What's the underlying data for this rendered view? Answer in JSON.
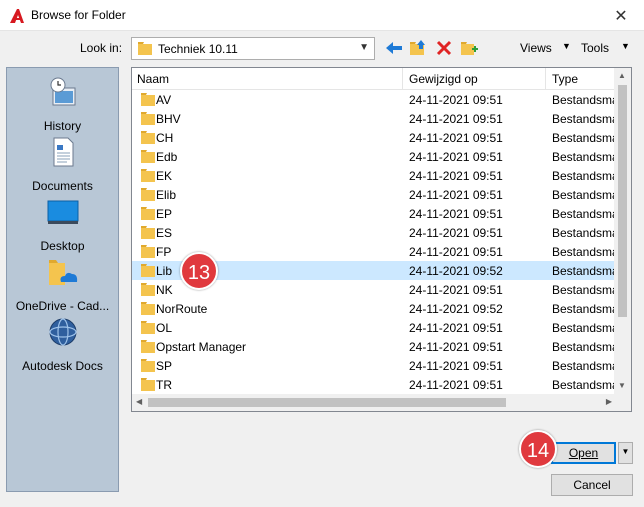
{
  "window": {
    "title": "Browse for Folder",
    "close_glyph": "✕"
  },
  "toolbar": {
    "lookin_label": "Look in:",
    "lookin_value": "Techniek 10.11",
    "views_label": "Views",
    "tools_label": "Tools"
  },
  "places": [
    {
      "label": "History",
      "icon": "history-icon"
    },
    {
      "label": "Documents",
      "icon": "documents-icon"
    },
    {
      "label": "Desktop",
      "icon": "desktop-icon"
    },
    {
      "label": "OneDrive - Cad...",
      "icon": "onedrive-icon"
    },
    {
      "label": "Autodesk Docs",
      "icon": "autodesk-docs-icon"
    }
  ],
  "columns": {
    "name": "Naam",
    "modified": "Gewijzigd op",
    "type": "Type"
  },
  "files": [
    {
      "name": "AV",
      "date": "24-11-2021 09:51",
      "type": "Bestandsma"
    },
    {
      "name": "BHV",
      "date": "24-11-2021 09:51",
      "type": "Bestandsma"
    },
    {
      "name": "CH",
      "date": "24-11-2021 09:51",
      "type": "Bestandsma"
    },
    {
      "name": "Edb",
      "date": "24-11-2021 09:51",
      "type": "Bestandsma"
    },
    {
      "name": "EK",
      "date": "24-11-2021 09:51",
      "type": "Bestandsma"
    },
    {
      "name": "Elib",
      "date": "24-11-2021 09:51",
      "type": "Bestandsma"
    },
    {
      "name": "EP",
      "date": "24-11-2021 09:51",
      "type": "Bestandsma"
    },
    {
      "name": "ES",
      "date": "24-11-2021 09:51",
      "type": "Bestandsma"
    },
    {
      "name": "FP",
      "date": "24-11-2021 09:51",
      "type": "Bestandsma"
    },
    {
      "name": "Lib",
      "date": "24-11-2021 09:52",
      "type": "Bestandsma",
      "selected": true
    },
    {
      "name": "NK",
      "date": "24-11-2021 09:51",
      "type": "Bestandsma"
    },
    {
      "name": "NorRoute",
      "date": "24-11-2021 09:52",
      "type": "Bestandsma"
    },
    {
      "name": "OL",
      "date": "24-11-2021 09:51",
      "type": "Bestandsma"
    },
    {
      "name": "Opstart Manager",
      "date": "24-11-2021 09:51",
      "type": "Bestandsma"
    },
    {
      "name": "SP",
      "date": "24-11-2021 09:51",
      "type": "Bestandsma"
    },
    {
      "name": "TR",
      "date": "24-11-2021 09:51",
      "type": "Bestandsma"
    }
  ],
  "buttons": {
    "open": "Open",
    "cancel": "Cancel"
  },
  "callouts": {
    "step_a": "13",
    "step_b": "14"
  },
  "colors": {
    "folder": "#f4c44e",
    "selection": "#cce8ff",
    "callout": "#e0393e",
    "autodesk_red": "#d71920"
  }
}
